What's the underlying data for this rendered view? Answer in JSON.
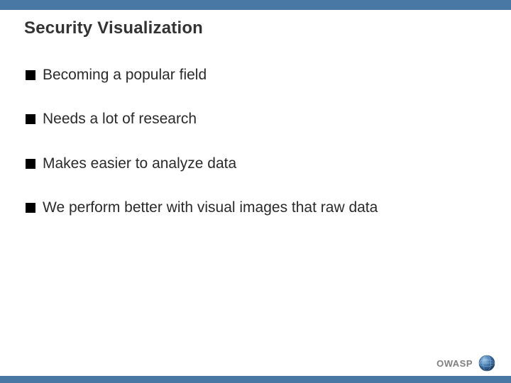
{
  "slide": {
    "title": "Security Visualization",
    "bullets": [
      "Becoming a popular field",
      "Needs a lot of research",
      "Makes easier to analyze data",
      "We perform better with visual images that raw data"
    ],
    "footer_label": "OWASP"
  },
  "colors": {
    "bar": "#4a78a4",
    "title": "#333333",
    "body": "#2a2a2a",
    "footer_text": "#808080"
  }
}
